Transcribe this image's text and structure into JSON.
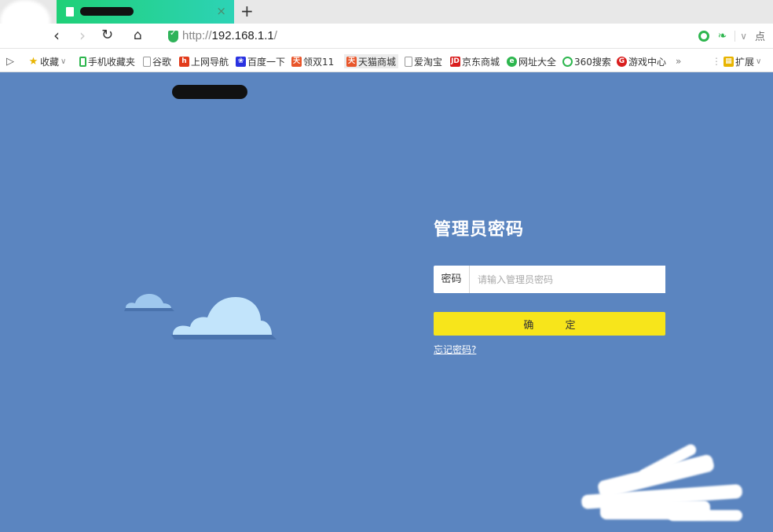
{
  "browser": {
    "tab_close": "×",
    "new_tab": "+",
    "url_scheme": "http://",
    "url_host": "192.168.1.1",
    "url_path": "/",
    "right_text": "点"
  },
  "bookmarks": [
    {
      "label": "收藏",
      "icon": "star-icon",
      "color": "#e8b400"
    },
    {
      "label": "手机收藏夹",
      "icon": "phone-icon",
      "color": "#2db64e"
    },
    {
      "label": "谷歌",
      "icon": "page-icon",
      "color": "#999999"
    },
    {
      "label": "上网导航",
      "icon": "hao-icon",
      "color": "#e23b1b"
    },
    {
      "label": "百度一下",
      "icon": "baidu-icon",
      "color": "#2932e1"
    },
    {
      "label": "领双11",
      "icon": "tmall-icon",
      "color": "#e8552a"
    },
    {
      "label": "天猫商城",
      "icon": "tmall-icon",
      "color": "#e8552a"
    },
    {
      "label": "爱淘宝",
      "icon": "page-icon",
      "color": "#999999"
    },
    {
      "label": "京东商城",
      "icon": "jd-icon",
      "color": "#d91e1e"
    },
    {
      "label": "网址大全",
      "icon": "wangzhi-icon",
      "color": "#2db64e"
    },
    {
      "label": "360搜索",
      "icon": "search360-icon",
      "color": "#2db64e"
    },
    {
      "label": "游戏中心",
      "icon": "game-icon",
      "color": "#d91e1e"
    }
  ],
  "bookmarks_more": "»",
  "bookmarks_ext": "扩展",
  "login": {
    "title": "管理员密码",
    "pwd_label": "密码",
    "pwd_placeholder": "请输入管理员密码",
    "pwd_value": "",
    "confirm_label": "确 定",
    "forgot_label": "忘记密码?"
  },
  "colors": {
    "page_bg": "#5b85c0",
    "confirm_bg": "#f7e51b",
    "tab_green": "#1fd077"
  }
}
